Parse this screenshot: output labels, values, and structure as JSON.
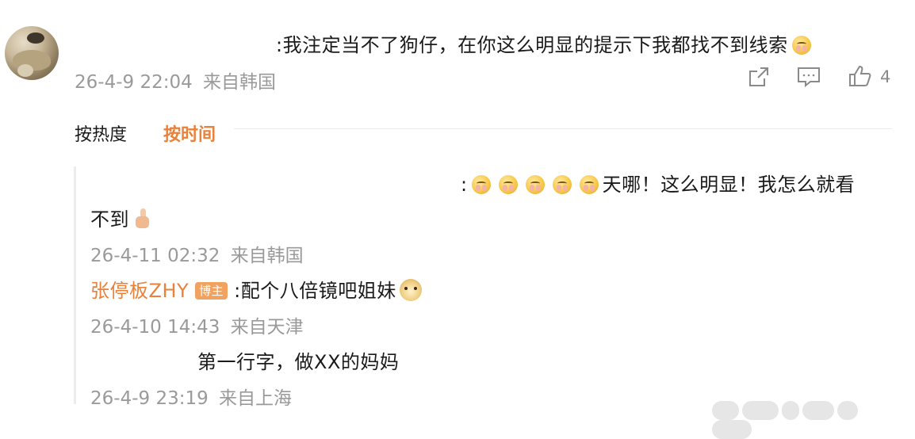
{
  "main_comment": {
    "text": ":我注定当不了狗仔，在你这么明显的提示下我都找不到线索",
    "emoji": "crying-face-emoji",
    "timestamp": "26-4-9 22:04",
    "location": "来自韩国",
    "like_count": "4",
    "icons": [
      "share-icon",
      "comment-icon",
      "like-icon"
    ]
  },
  "sort_tabs": {
    "by_heat": "按热度",
    "by_time": "按时间",
    "active": "by_time",
    "active_color": "#e9813a"
  },
  "replies": [
    {
      "text_line1": ":",
      "text_line1_rest": "天哪！这么明显！我怎么就看",
      "text_line2": "不到",
      "emojis": [
        "crying-face-emoji",
        "crying-face-emoji",
        "crying-face-emoji",
        "crying-face-emoji",
        "crying-face-emoji",
        "thumbs-up-emoji"
      ],
      "timestamp": "26-4-11 02:32",
      "location": "来自韩国"
    },
    {
      "author": "张停板ZHY",
      "badge": "博主",
      "text": ":配个八倍镜吧姐妹",
      "emoji": "doge-emoji",
      "timestamp": "26-4-10 14:43",
      "location": "来自天津"
    },
    {
      "text": "第一行字，做XX的妈妈",
      "timestamp": "26-4-9 23:19",
      "location": "来自上海"
    }
  ]
}
